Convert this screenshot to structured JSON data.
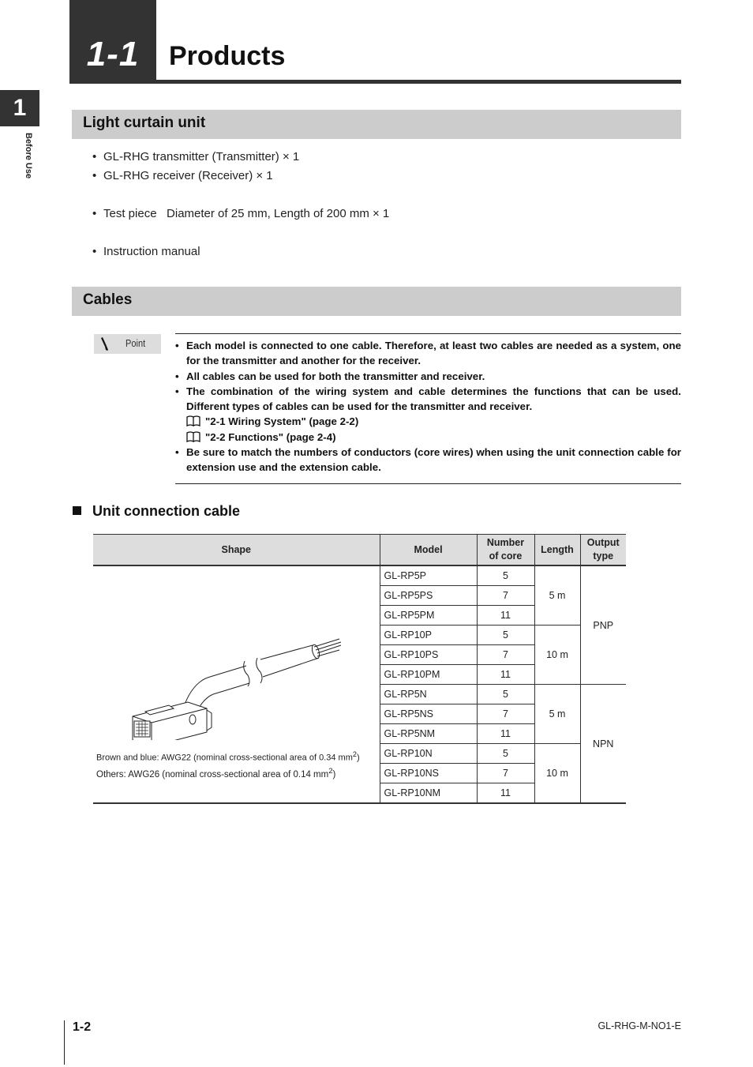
{
  "chapter": {
    "number": "1-1",
    "title": "Products"
  },
  "side_tab": {
    "number": "1",
    "label": "Before Use"
  },
  "sections": {
    "light_curtain": {
      "title": "Light curtain unit",
      "items": [
        "GL-RHG transmitter (Transmitter) × 1",
        "GL-RHG receiver (Receiver) × 1",
        "Test piece   Diameter of 25 mm, Length of 200 mm × 1",
        "Instruction manual"
      ]
    },
    "cables": {
      "title": "Cables",
      "point": {
        "label": "Point",
        "items": [
          "Each model is connected to one cable. Therefore, at least two cables are needed as a system, one for the transmitter and another for the receiver.",
          "All cables can be used for both the transmitter and receiver.",
          "The combination of the wiring system and cable determines the functions that can be used. Different types of cables can be used for the transmitter and receiver.",
          "Be sure to match the numbers of conductors (core wires) when using the unit connection cable for extension use and the extension cable."
        ],
        "references": [
          "\"2-1 Wiring System\" (page 2-2)",
          "\"2-2 Functions\" (page 2-4)"
        ]
      }
    },
    "unit_connection_cable": {
      "title": "Unit connection cable",
      "table": {
        "headers": {
          "shape": "Shape",
          "model": "Model",
          "core_line1": "Number",
          "core_line2": "of core",
          "length": "Length",
          "output_line1": "Output",
          "output_line2": "type"
        },
        "rows": [
          {
            "model": "GL-RP5P",
            "cores": "5"
          },
          {
            "model": "GL-RP5PS",
            "cores": "7"
          },
          {
            "model": "GL-RP5PM",
            "cores": "11"
          },
          {
            "model": "GL-RP10P",
            "cores": "5"
          },
          {
            "model": "GL-RP10PS",
            "cores": "7"
          },
          {
            "model": "GL-RP10PM",
            "cores": "11"
          },
          {
            "model": "GL-RP5N",
            "cores": "5"
          },
          {
            "model": "GL-RP5NS",
            "cores": "7"
          },
          {
            "model": "GL-RP5NM",
            "cores": "11"
          },
          {
            "model": "GL-RP10N",
            "cores": "5"
          },
          {
            "model": "GL-RP10NS",
            "cores": "7"
          },
          {
            "model": "GL-RP10NM",
            "cores": "11"
          }
        ],
        "lengths": [
          "5 m",
          "10 m",
          "5 m",
          "10 m"
        ],
        "output_types": [
          "PNP",
          "NPN"
        ],
        "shape_notes": {
          "line1_prefix": "Brown and blue: AWG22 (nominal cross-sectional area of 0.34 mm",
          "line2_prefix": "Others: AWG26 (nominal cross-sectional area of 0.14 mm",
          "superscript": "2",
          "suffix": ")"
        }
      }
    }
  },
  "footer": {
    "page": "1-2",
    "doc_code": "GL-RHG-M-NO1-E"
  }
}
